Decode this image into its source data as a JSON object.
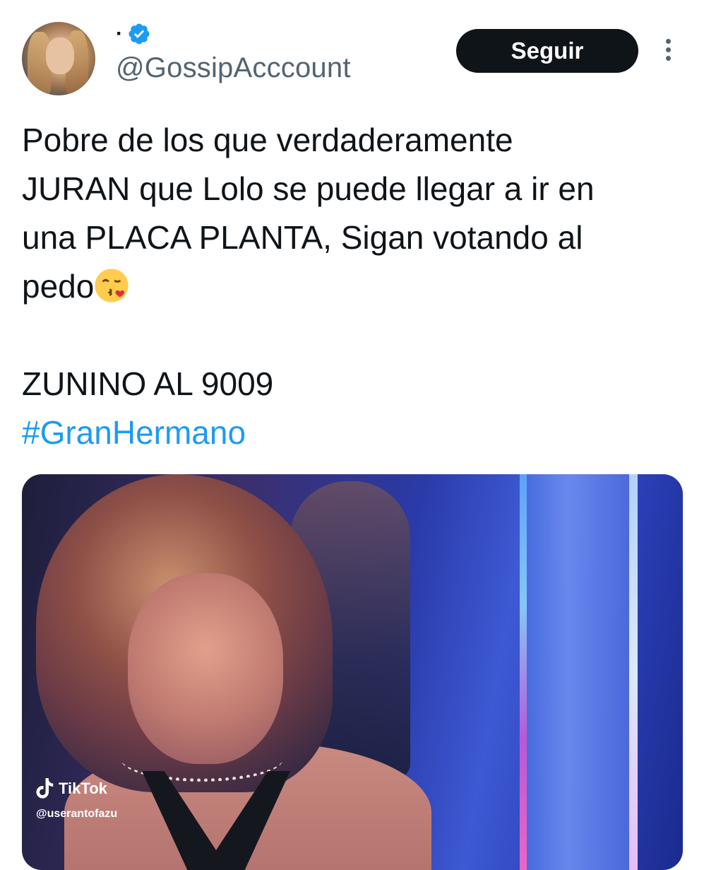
{
  "author": {
    "display_name": "·",
    "handle": "@GossipAcccount",
    "verified": true
  },
  "follow_button": {
    "label": "Seguir"
  },
  "tweet": {
    "line1": "Pobre de los que verdaderamente",
    "line2": "JURAN que Lolo se puede llegar a ir en",
    "line3": "una PLACA PLANTA, Sigan votando al",
    "line4": "pedo",
    "emoji": "face-blowing-a-kiss",
    "line5": "ZUNINO AL 9009",
    "hashtag": "#GranHermano"
  },
  "media": {
    "watermark_brand": "TikTok",
    "watermark_user": "@userantofazu"
  },
  "colors": {
    "text": "#0f1419",
    "secondary_text": "#536471",
    "link": "#1d9bf0",
    "button_bg": "#0f1419",
    "button_text": "#ffffff"
  },
  "icons": {
    "verified": "verified-badge-icon",
    "more": "more-options-icon",
    "tiktok": "tiktok-logo-icon"
  }
}
